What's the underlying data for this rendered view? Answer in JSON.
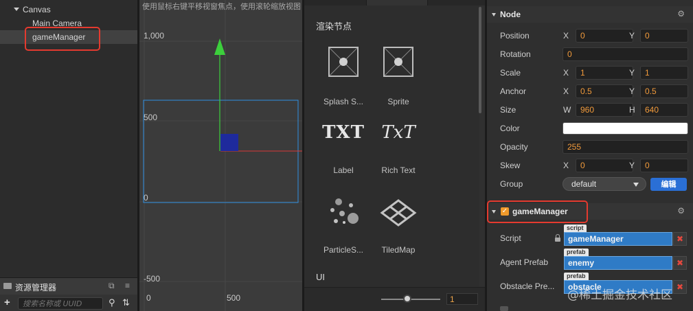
{
  "hierarchy": {
    "items": [
      {
        "label": "Canvas"
      },
      {
        "label": "Main Camera"
      },
      {
        "label": "gameManager"
      }
    ]
  },
  "assets": {
    "title": "资源管理器",
    "search_placeholder": "搜索名称或 UUID"
  },
  "scene": {
    "hint": "使用鼠标右键平移视窗焦点，使用滚轮缩放视图",
    "y_labels": [
      "1,000",
      "500",
      "0",
      "-500"
    ],
    "x_labels": [
      "0",
      "500"
    ]
  },
  "node_library": {
    "section_render": "渲染节点",
    "components": [
      {
        "label": "Splash S...",
        "icon": "splash-sprite-icon"
      },
      {
        "label": "Sprite",
        "icon": "sprite-icon"
      },
      {
        "label": "Label",
        "icon": "label-icon",
        "glyph": "TXT"
      },
      {
        "label": "Rich Text",
        "icon": "rich-text-icon",
        "glyph": "TxT"
      },
      {
        "label": "ParticleS...",
        "icon": "particle-system-icon"
      },
      {
        "label": "TiledMap",
        "icon": "tiled-map-icon"
      }
    ],
    "section_ui": "UI",
    "zoom_value": "1"
  },
  "inspector": {
    "node_title": "Node",
    "properties": {
      "position": {
        "label": "Position",
        "x_label": "X",
        "x": "0",
        "y_label": "Y",
        "y": "0"
      },
      "rotation": {
        "label": "Rotation",
        "value": "0"
      },
      "scale": {
        "label": "Scale",
        "x_label": "X",
        "x": "1",
        "y_label": "Y",
        "y": "1"
      },
      "anchor": {
        "label": "Anchor",
        "x_label": "X",
        "x": "0.5",
        "y_label": "Y",
        "y": "0.5"
      },
      "size": {
        "label": "Size",
        "w_label": "W",
        "w": "960",
        "h_label": "H",
        "h": "640"
      },
      "color": {
        "label": "Color",
        "value": "#ffffff"
      },
      "opacity": {
        "label": "Opacity",
        "value": "255"
      },
      "skew": {
        "label": "Skew",
        "x_label": "X",
        "x": "0",
        "y_label": "Y",
        "y": "0"
      },
      "group": {
        "label": "Group",
        "value": "default",
        "edit_label": "编辑"
      }
    },
    "component": {
      "title": "gameManager",
      "enabled": true,
      "script": {
        "label": "Script",
        "tag": "script",
        "value": "gameManager"
      },
      "agent_prefab": {
        "label": "Agent Prefab",
        "tag": "prefab",
        "value": "enemy"
      },
      "obstacle_prefab": {
        "label": "Obstacle Pre...",
        "tag": "prefab",
        "value": "obstacle"
      }
    }
  },
  "watermark": "@稀土掘金技术社区",
  "colors": {
    "highlight": "#e53a2f",
    "value_orange": "#f19a3b",
    "asset_blue": "#2f7bc6",
    "edit_blue": "#2a6fd6"
  }
}
